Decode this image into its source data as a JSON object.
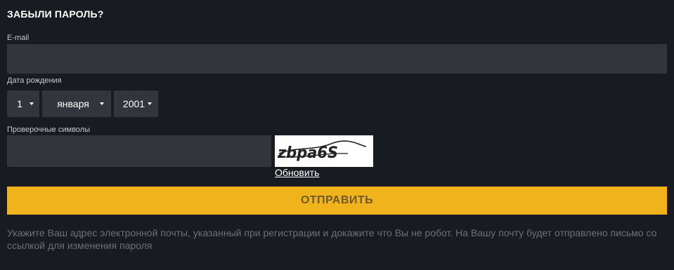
{
  "form": {
    "title": "ЗАБЫЛИ ПАРОЛЬ?",
    "email_label": "E-mail",
    "email_value": "",
    "birthdate_label": "Дата рождения",
    "day": "1",
    "month": "января",
    "year": "2001",
    "captcha_label": "Проверочные символы",
    "captcha_value": "",
    "captcha_text": "zbpa6S",
    "refresh_label": "Обновить",
    "submit_label": "ОТПРАВИТЬ",
    "note": "Укажите Ваш адрес электронной почты, указанный при регистрации и докажите что Вы не робот. На Вашу почту будет отправлено письмо со ссылкой для изменения пароля"
  },
  "colors": {
    "background": "#181b21",
    "input_bg": "#32353c",
    "accent": "#f1b31c",
    "button_text": "#6f5a26",
    "muted_text": "#6e7077"
  }
}
